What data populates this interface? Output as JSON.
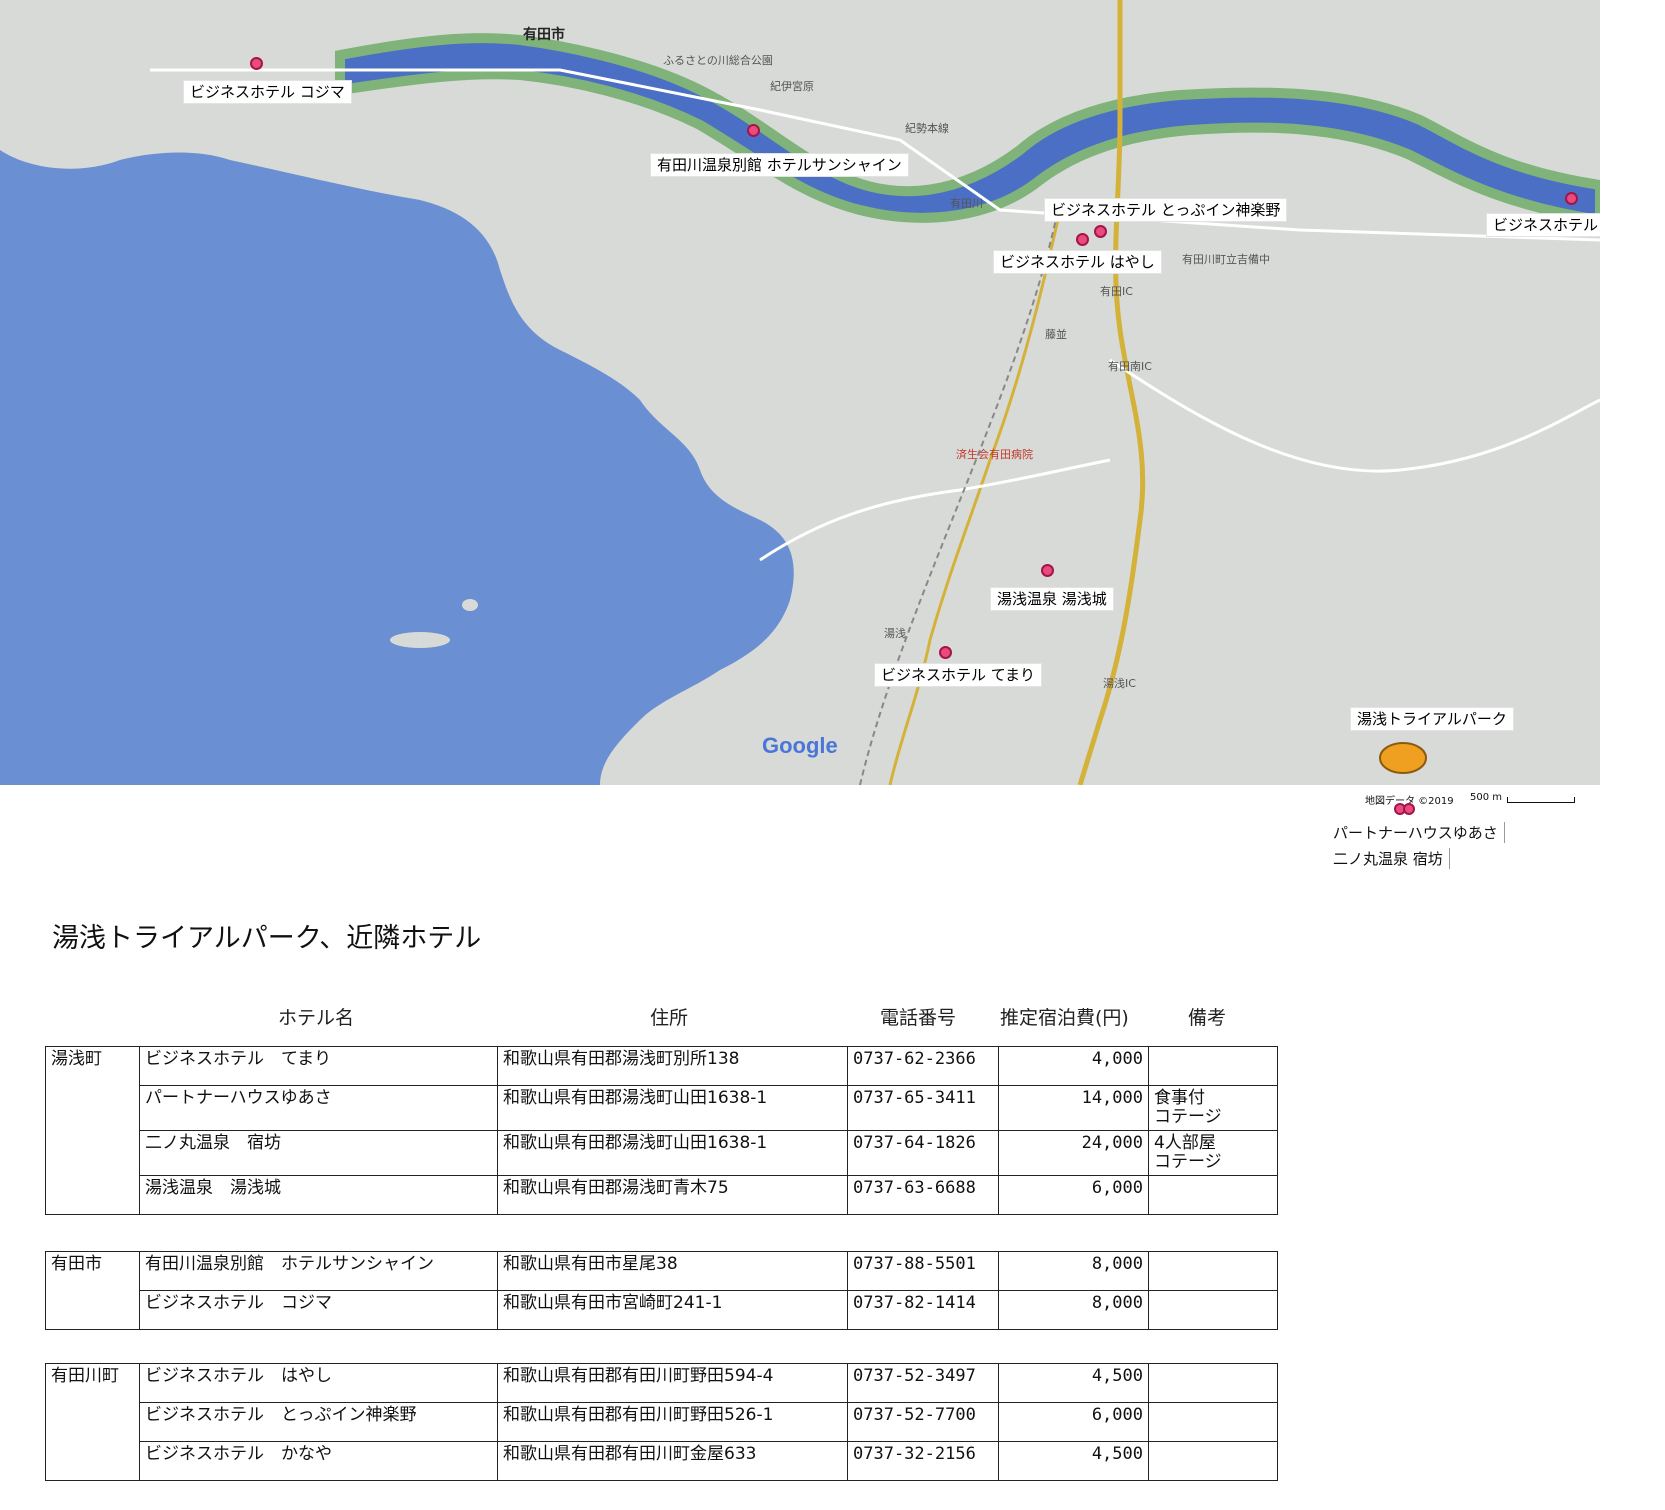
{
  "map": {
    "hotel_labels": [
      {
        "id": "kojima",
        "label": "ビジネスホテル コジマ"
      },
      {
        "id": "sunshine",
        "label": "有田川温泉別館 ホテルサンシャイン"
      },
      {
        "id": "toppuin",
        "label": "ビジネスホテル とっぷイン神楽野"
      },
      {
        "id": "hayashi",
        "label": "ビジネスホテル はやし"
      },
      {
        "id": "kanaya",
        "label": "ビジネスホテル かなや"
      },
      {
        "id": "yuasajo",
        "label": "湯浅温泉 湯浅城"
      },
      {
        "id": "temari",
        "label": "ビジネスホテル てまり"
      },
      {
        "id": "trialpark",
        "label": "湯浅トライアルパーク"
      }
    ],
    "place_names": {
      "arida_city": "有田市",
      "kibi": "有田川町立吉備中",
      "yuasa_ic": "湯浅IC",
      "arida_ic": "有田IC",
      "arida_minami_ic": "有田南IC",
      "yuasa_station": "湯浅",
      "kishu_miyahara": "紀伊宮原",
      "fujinami": "藤並",
      "hospital": "済生会有田病院",
      "river": "有田川",
      "line": "紀勢本線",
      "furusato": "ふるさとの川総合公園"
    },
    "google_logo": "Google",
    "attribution": "地図データ ©2019",
    "scale": "500 m",
    "below_map_labels": [
      "パートナーハウスゆあさ",
      "二ノ丸温泉 宿坊"
    ]
  },
  "document": {
    "title": "湯浅トライアルパーク、近隣ホテル",
    "headers": {
      "name": "ホテル名",
      "address": "住所",
      "phone": "電話番号",
      "price": "推定宿泊費(円)",
      "notes": "備考"
    },
    "groups": [
      {
        "region": "湯浅町",
        "rows": [
          {
            "name": "ビジネスホテル　てまり",
            "address": "和歌山県有田郡湯浅町別所138",
            "phone": "0737-62-2366",
            "price": "4,000",
            "notes": [
              "",
              ""
            ]
          },
          {
            "name": "パートナーハウスゆあさ",
            "address": "和歌山県有田郡湯浅町山田1638-1",
            "phone": "0737-65-3411",
            "price": "14,000",
            "notes": [
              "食事付",
              "コテージ"
            ]
          },
          {
            "name": "二ノ丸温泉　宿坊",
            "address": "和歌山県有田郡湯浅町山田1638-1",
            "phone": "0737-64-1826",
            "price": "24,000",
            "notes": [
              "4人部屋",
              "コテージ"
            ]
          },
          {
            "name": "湯浅温泉　湯浅城",
            "address": "和歌山県有田郡湯浅町青木75",
            "phone": "0737-63-6688",
            "price": "6,000",
            "notes": [
              "",
              ""
            ]
          }
        ]
      },
      {
        "region": "有田市",
        "rows": [
          {
            "name": "有田川温泉別館　ホテルサンシャイン",
            "address": "和歌山県有田市星尾38",
            "phone": "0737-88-5501",
            "price": "8,000",
            "notes": [
              "",
              ""
            ]
          },
          {
            "name": "ビジネスホテル　コジマ",
            "address": "和歌山県有田市宮崎町241-1",
            "phone": "0737-82-1414",
            "price": "8,000",
            "notes": [
              "",
              ""
            ]
          }
        ]
      },
      {
        "region": "有田川町",
        "rows": [
          {
            "name": "ビジネスホテル　はやし",
            "address": "和歌山県有田郡有田川町野田594-4",
            "phone": "0737-52-3497",
            "price": "4,500",
            "notes": [
              "",
              ""
            ]
          },
          {
            "name": "ビジネスホテル　とっぷイン神楽野",
            "address": "和歌山県有田郡有田川町野田526-1",
            "phone": "0737-52-7700",
            "price": "6,000",
            "notes": [
              "",
              ""
            ]
          },
          {
            "name": "ビジネスホテル　かなや",
            "address": "和歌山県有田郡有田川町金屋633",
            "phone": "0737-32-2156",
            "price": "4,500",
            "notes": [
              "",
              ""
            ]
          }
        ]
      }
    ]
  },
  "colors": {
    "sea": "#6b8fd3",
    "river": "#4a6fc5",
    "riverbank": "#7fb37a",
    "land": "#d8dad7",
    "marker": "#e94b7e",
    "trial_park": "#f0a020",
    "highway": "#d4b23a"
  }
}
